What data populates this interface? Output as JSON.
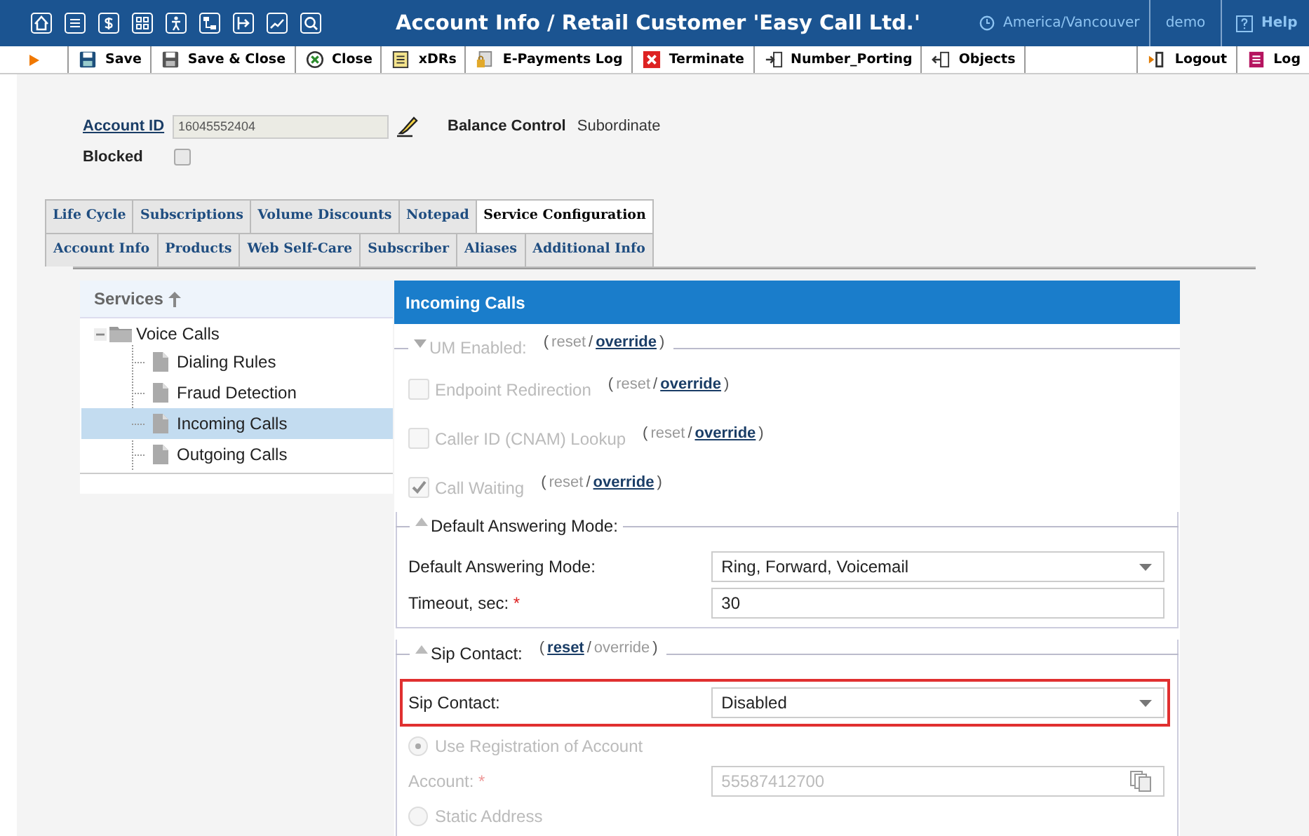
{
  "header": {
    "title": "Account Info / Retail Customer 'Easy Call Ltd.'",
    "timezone": "America/Vancouver",
    "user": "demo",
    "help": "Help"
  },
  "toolbar": {
    "buttons": [
      {
        "kind": "save",
        "label": "Save"
      },
      {
        "kind": "saveclose",
        "label": "Save & Close"
      },
      {
        "kind": "close",
        "label": "Close"
      },
      {
        "kind": "xdrs",
        "label": "xDRs"
      },
      {
        "kind": "payments",
        "label": "E-Payments Log"
      },
      {
        "kind": "terminate",
        "label": "Terminate"
      },
      {
        "kind": "porting",
        "label": "Number_Porting"
      },
      {
        "kind": "objects",
        "label": "Objects"
      }
    ],
    "right": [
      {
        "kind": "logout",
        "label": "Logout"
      },
      {
        "kind": "log",
        "label": "Log"
      }
    ]
  },
  "account": {
    "id_label": "Account ID",
    "id_value": "16045552404",
    "balance_label": "Balance Control",
    "balance_value": "Subordinate",
    "blocked_label": "Blocked",
    "blocked_checked": false
  },
  "tabs": [
    [
      {
        "label": "Life Cycle",
        "selected": false
      },
      {
        "label": "Subscriptions",
        "selected": false
      },
      {
        "label": "Volume Discounts",
        "selected": false
      },
      {
        "label": "Notepad",
        "selected": false
      },
      {
        "label": "Service Configuration",
        "selected": true
      }
    ],
    [
      {
        "label": "Account Info",
        "selected": false
      },
      {
        "label": "Products",
        "selected": false
      },
      {
        "label": "Web Self-Care",
        "selected": false
      },
      {
        "label": "Subscriber",
        "selected": false
      },
      {
        "label": "Aliases",
        "selected": false
      },
      {
        "label": "Additional Info",
        "selected": false
      }
    ]
  ],
  "services": {
    "title": "Services",
    "tree": [
      {
        "label": "Voice Calls",
        "expanded": true,
        "selected": false,
        "children": [
          {
            "label": "Dialing Rules",
            "selected": false
          },
          {
            "label": "Fraud Detection",
            "selected": false
          },
          {
            "label": "Incoming Calls",
            "selected": true
          },
          {
            "label": "Outgoing Calls",
            "selected": false
          }
        ]
      }
    ]
  },
  "panel": {
    "title": "Incoming Calls",
    "items": [
      {
        "kind": "group",
        "label": "UM Enabled:",
        "expanded": false,
        "disabled": true,
        "links": {
          "open": "(",
          "sep": "/",
          "close": ")",
          "reset": {
            "label": "reset",
            "active": false
          },
          "override": {
            "label": "override",
            "active": true
          }
        }
      },
      {
        "kind": "checkbox",
        "label": "Endpoint Redirection",
        "checked": false,
        "disabled": true,
        "links": {
          "open": "(",
          "sep": "/",
          "close": ")",
          "reset": {
            "label": "reset",
            "active": false
          },
          "override": {
            "label": "override",
            "active": true
          }
        }
      },
      {
        "kind": "checkbox",
        "label": "Caller ID (CNAM) Lookup",
        "checked": false,
        "disabled": true,
        "links": {
          "open": "(",
          "sep": "/",
          "close": ")",
          "reset": {
            "label": "reset",
            "active": false
          },
          "override": {
            "label": "override",
            "active": true
          }
        }
      },
      {
        "kind": "checkbox",
        "label": "Call Waiting",
        "checked": true,
        "disabled": true,
        "links": {
          "open": "(",
          "sep": "/",
          "close": ")",
          "reset": {
            "label": "reset",
            "active": false
          },
          "override": {
            "label": "override",
            "active": true
          }
        }
      },
      {
        "kind": "group",
        "label": "Default Answering Mode:",
        "expanded": true,
        "disabled": false,
        "fields": [
          {
            "kind": "select",
            "label": "Default Answering Mode:",
            "value": "Ring, Forward, Voicemail",
            "highlighted": false
          },
          {
            "kind": "input",
            "label": "Timeout, sec:",
            "required_mark": "*",
            "value": "30",
            "disabled": false
          }
        ]
      },
      {
        "kind": "group",
        "label": "Sip Contact:",
        "expanded": true,
        "disabled": false,
        "links": {
          "open": "(",
          "sep": "/",
          "close": ")",
          "reset": {
            "label": "reset",
            "active": true
          },
          "override": {
            "label": "override",
            "active": false
          }
        },
        "fields": [
          {
            "kind": "select",
            "label": "Sip Contact:",
            "value": "Disabled",
            "highlighted": true
          },
          {
            "kind": "radio",
            "label": "Use Registration of Account",
            "selected": true,
            "disabled": true
          },
          {
            "kind": "input",
            "label": "Account:",
            "required_mark": "*",
            "value": "55587412700",
            "disabled": true,
            "copy": true
          },
          {
            "kind": "radio",
            "label": "Static Address",
            "selected": false,
            "disabled": true
          }
        ]
      }
    ]
  }
}
